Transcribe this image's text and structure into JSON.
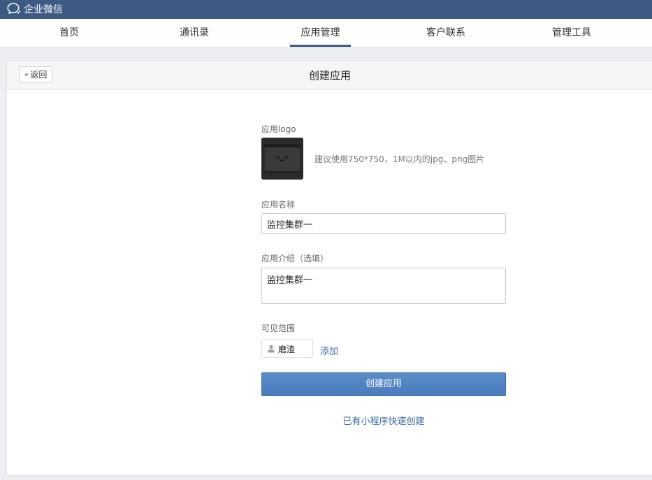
{
  "app": {
    "title": "企业微信"
  },
  "nav": {
    "items": [
      {
        "label": "首页"
      },
      {
        "label": "通讯录"
      },
      {
        "label": "应用管理"
      },
      {
        "label": "客户联系"
      },
      {
        "label": "管理工具"
      }
    ],
    "active": "应用管理"
  },
  "header": {
    "back_label": "返回",
    "title": "创建应用"
  },
  "form": {
    "logo_label": "应用logo",
    "logo_hint": "建议使用750*750，1M以内的jpg、png图片",
    "name_label": "应用名称",
    "name_value": "监控集群一",
    "intro_label": "应用介绍（选填）",
    "intro_value": "监控集群一",
    "visibility_label": "可见范围",
    "member_name": "磨渣",
    "add_label": "添加",
    "submit_label": "创建应用",
    "miniprogram_link": "已有小程序快速创建"
  },
  "icons": {
    "brand": "wechat-work-icon",
    "back": "double-chevron-left-icon",
    "member": "user-icon"
  },
  "colors": {
    "topbar": "#3c5a84",
    "primary_button": "#4a7bbb",
    "link": "#3a6aa6"
  }
}
